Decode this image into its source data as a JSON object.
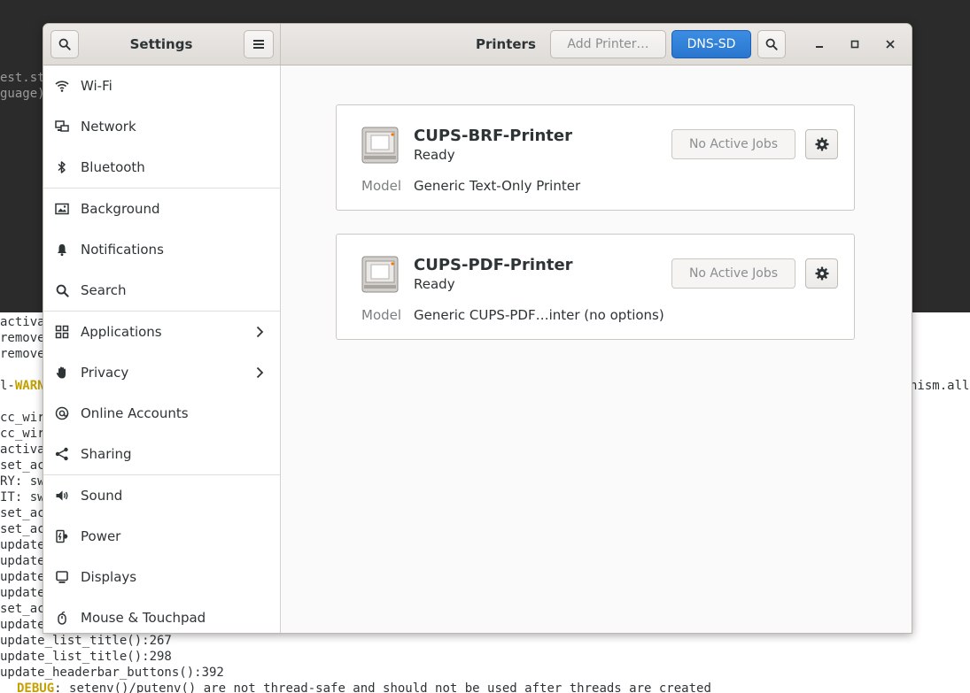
{
  "terminal_top": {
    "lines": [
      "est.st",
      "guage)"
    ]
  },
  "terminal_bottom": {
    "lines": [
      "activa",
      "remove",
      "remove",
      "",
      "l-",
      "",
      "cc_wir",
      "cc_wir",
      "activa",
      "set_ac",
      "RY: sw",
      "IT: sw",
      "set_ac",
      "set_ac",
      "update",
      "update",
      "update",
      "update",
      "set_ac",
      "update",
      "update_list_title():267",
      "update_list_title():298",
      "update_headerbar_buttons():392"
    ],
    "warn_word": "WARN",
    "right_fragment": "nism.all",
    "debug_prefix": "DEBUG",
    "debug_text": ": setenv()/putenv() are not thread-safe and should not be used after threads are created"
  },
  "header": {
    "sidebar_title": "Settings",
    "panel_title": "Printers",
    "add_printer_label": "Add Printer…",
    "dns_sd_label": "DNS-SD",
    "search_icon": "search-icon",
    "menu_icon": "hamburger-menu-icon"
  },
  "sidebar": {
    "items": [
      {
        "label": "Wi-Fi",
        "icon": "wifi-icon"
      },
      {
        "label": "Network",
        "icon": "network-icon"
      },
      {
        "label": "Bluetooth",
        "icon": "bluetooth-icon"
      },
      {
        "label": "Background",
        "icon": "background-icon"
      },
      {
        "label": "Notifications",
        "icon": "bell-icon"
      },
      {
        "label": "Search",
        "icon": "search-icon"
      },
      {
        "label": "Applications",
        "icon": "apps-grid-icon"
      },
      {
        "label": "Privacy",
        "icon": "hand-icon"
      },
      {
        "label": "Online Accounts",
        "icon": "at-icon"
      },
      {
        "label": "Sharing",
        "icon": "share-icon"
      },
      {
        "label": "Sound",
        "icon": "speaker-icon"
      },
      {
        "label": "Power",
        "icon": "power-icon"
      },
      {
        "label": "Displays",
        "icon": "display-icon"
      },
      {
        "label": "Mouse & Touchpad",
        "icon": "mouse-icon"
      }
    ]
  },
  "printers": [
    {
      "name": "CUPS-BRF-Printer",
      "state": "Ready",
      "jobs_label": "No Active Jobs",
      "model_label": "Model",
      "model": "Generic Text-Only Printer"
    },
    {
      "name": "CUPS-PDF-Printer",
      "state": "Ready",
      "jobs_label": "No Active Jobs",
      "model_label": "Model",
      "model": "Generic CUPS-PDF…inter (no options)"
    }
  ],
  "colors": {
    "accent": "#3584e4",
    "terminal_bg": "#2b2b2b",
    "warn": "#c4a000"
  }
}
